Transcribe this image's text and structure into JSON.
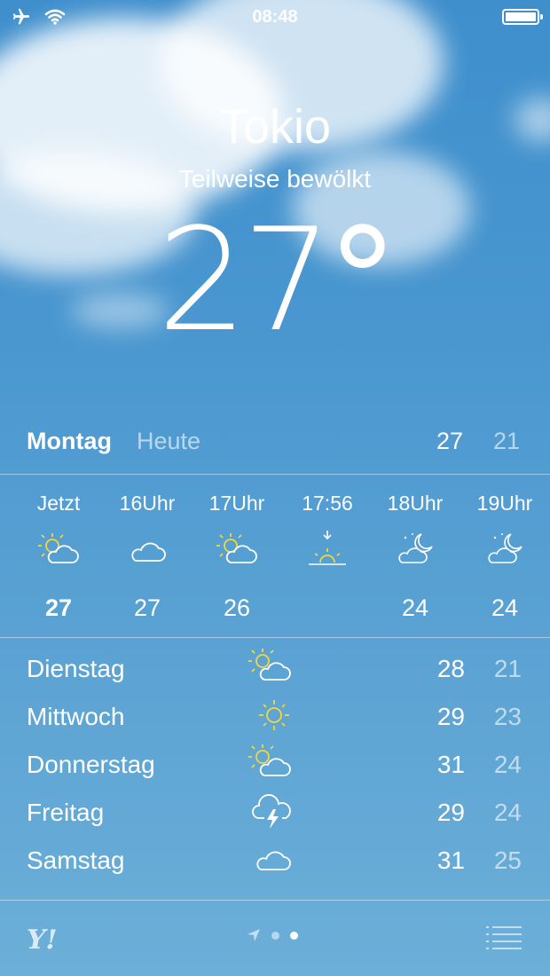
{
  "status_bar": {
    "time": "08:48",
    "icons": [
      "airplane-icon",
      "wifi-icon",
      "battery-icon"
    ]
  },
  "current": {
    "city": "Tokio",
    "condition": "Teilweise bewölkt",
    "temperature": "27",
    "degree_symbol": "°"
  },
  "today": {
    "day": "Montag",
    "label": "Heute",
    "high": "27",
    "low": "21"
  },
  "hourly": [
    {
      "time": "Jetzt",
      "icon": "partly-sunny-icon",
      "temp": "27"
    },
    {
      "time": "16Uhr",
      "icon": "cloud-icon",
      "temp": "27"
    },
    {
      "time": "17Uhr",
      "icon": "partly-sunny-icon",
      "temp": "26"
    },
    {
      "time": "17:56",
      "icon": "sunset-icon",
      "temp": ""
    },
    {
      "time": "18Uhr",
      "icon": "partly-cloudy-night-icon",
      "temp": "24"
    },
    {
      "time": "19Uhr",
      "icon": "partly-cloudy-night-icon",
      "temp": "24"
    }
  ],
  "daily": [
    {
      "day": "Dienstag",
      "icon": "partly-sunny-icon",
      "high": "28",
      "low": "21"
    },
    {
      "day": "Mittwoch",
      "icon": "sun-icon",
      "high": "29",
      "low": "23"
    },
    {
      "day": "Donnerstag",
      "icon": "partly-sunny-icon",
      "high": "31",
      "low": "24"
    },
    {
      "day": "Freitag",
      "icon": "thunderstorm-icon",
      "high": "29",
      "low": "24"
    },
    {
      "day": "Samstag",
      "icon": "cloud-icon",
      "high": "31",
      "low": "25"
    }
  ],
  "bottom_bar": {
    "logo": "Y!",
    "page_indicator": {
      "pages": 2,
      "active": 2,
      "has_location_arrow": true
    },
    "list_icon": "list-icon"
  },
  "colors": {
    "sky_top": "#3f8fcd",
    "sky_bottom": "#6cafd9",
    "sun_yellow": "#f5d63a"
  }
}
